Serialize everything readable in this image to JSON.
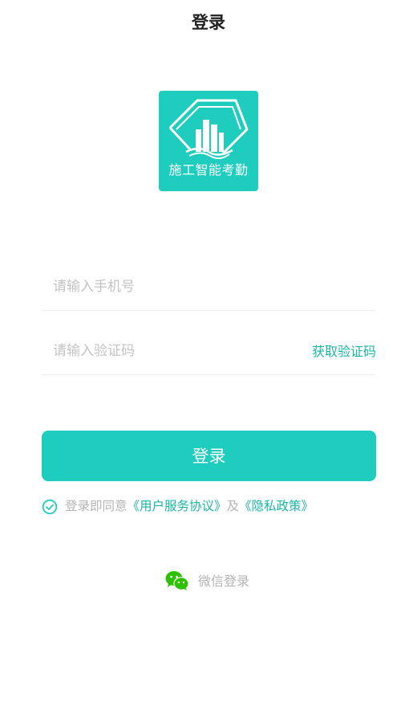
{
  "header": {
    "title": "登录"
  },
  "logo": {
    "caption": "施工智能考勤",
    "color": "#1ecdbd"
  },
  "form": {
    "phone": {
      "placeholder": "请输入手机号",
      "value": ""
    },
    "code": {
      "placeholder": "请输入验证码",
      "value": "",
      "get_code_label": "获取验证码"
    },
    "submit_label": "登录"
  },
  "agreement": {
    "checked": true,
    "prefix": "登录即同意",
    "terms_link": "《用户服务协议》",
    "conjunction": "及",
    "privacy_link": "《隐私政策》"
  },
  "wechat_login": {
    "label": "微信登录",
    "icon": "wechat-icon",
    "color": "#2dc100"
  },
  "colors": {
    "accent": "#1ecdbd",
    "link": "#1ab5a6",
    "muted": "#b4b4b4"
  }
}
